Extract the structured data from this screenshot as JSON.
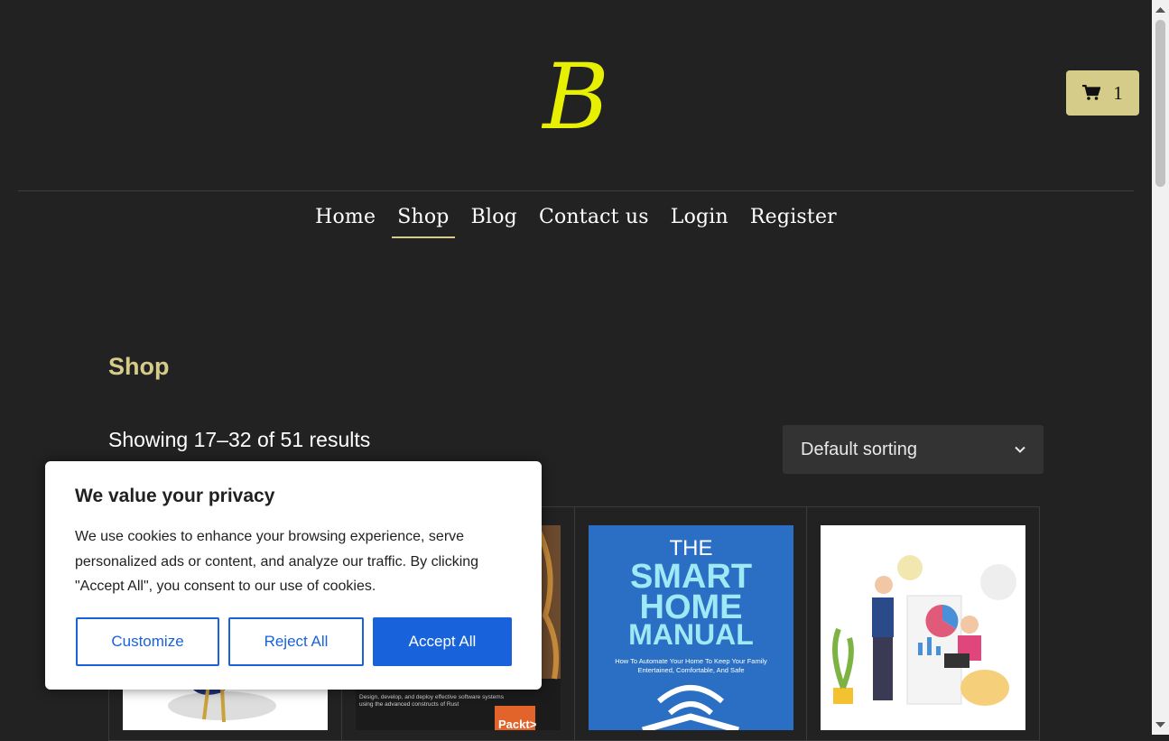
{
  "brand": {
    "logo_letter": "B",
    "logo_color": "#e6f000"
  },
  "cart": {
    "count": "1",
    "icon": "cart-icon"
  },
  "nav": {
    "items": [
      {
        "label": "Home",
        "active": false
      },
      {
        "label": "Shop",
        "active": true
      },
      {
        "label": "Blog",
        "active": false
      },
      {
        "label": "Contact us",
        "active": false
      },
      {
        "label": "Login",
        "active": false
      },
      {
        "label": "Register",
        "active": false
      }
    ]
  },
  "page": {
    "title": "Shop",
    "result_count": "Showing 17–32 of 51 results",
    "sort_selected": "Default sorting"
  },
  "products": {
    "book2_tagline": "Design, develop, and deploy effective software systems using the advanced constructs of Rust",
    "book2_publisher": "Packt>",
    "book3_title_line1": "THE",
    "book3_title_line2": "SMART",
    "book3_title_line3": "HOME",
    "book3_title_line4": "MANUAL",
    "book3_subtitle": "How To Automate Your Home To Keep Your Family Entertained, Comfortable, And Safe"
  },
  "cookie_banner": {
    "title": "We value your privacy",
    "body": "We use cookies to enhance your browsing experience, serve personalized ads or content, and analyze our traffic. By clicking \"Accept All\", you consent to our use of cookies.",
    "customize": "Customize",
    "reject": "Reject All",
    "accept": "Accept All"
  },
  "colors": {
    "accent": "#d6cc8a",
    "background": "#222222",
    "button_blue": "#1863dc"
  }
}
